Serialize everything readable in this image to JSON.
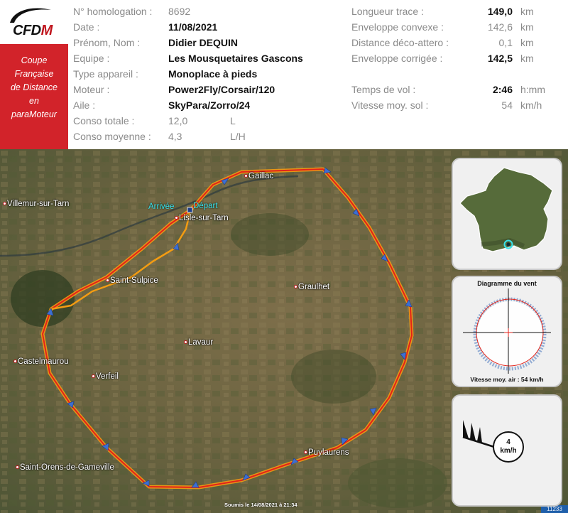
{
  "logo": {
    "text_black": "CFD",
    "text_red": "M"
  },
  "sidebar": {
    "lines": [
      "Coupe",
      "Française",
      "de Distance",
      "en",
      "paraMoteur"
    ]
  },
  "flight": {
    "labels": [
      "N° homologation :",
      "Date :",
      "Prénom, Nom :",
      "Equipe :",
      "Type appareil :",
      "Moteur :",
      "Aile :",
      "Conso totale :",
      "Conso moyenne :"
    ],
    "homologation": "8692",
    "date": "11/08/2021",
    "pilot": "Didier DEQUIN",
    "team": "Les Mousquetaires Gascons",
    "aircraft_type": "Monoplace à pieds",
    "engine": "Power2Fly/Corsair/120",
    "wing": "SkyPara/Zorro/24",
    "conso_totale": "12,0",
    "conso_totale_unit": "L",
    "conso_moyenne": "4,3",
    "conso_moyenne_unit": "L/H"
  },
  "stats": {
    "rows": [
      {
        "label": "Longueur trace :",
        "value": "149,0",
        "unit": "km",
        "bold": true
      },
      {
        "label": "Enveloppe convexe :",
        "value": "142,6",
        "unit": "km",
        "bold": false
      },
      {
        "label": "Distance déco-attero :",
        "value": "0,1",
        "unit": "km",
        "bold": false
      },
      {
        "label": "Enveloppe corrigée :",
        "value": "142,5",
        "unit": "km",
        "bold": true
      }
    ],
    "rows2": [
      {
        "label": "Temps de vol :",
        "value": "2:46",
        "unit": "h:mm",
        "bold": true
      },
      {
        "label": "Vitesse moy. sol :",
        "value": "54",
        "unit": "km/h",
        "bold": false
      }
    ]
  },
  "map": {
    "towns": [
      "Gaillac",
      "Villemur-sur-Tarn",
      "Lisle-sur-Tarn",
      "Saint-Sulpice",
      "Graulhet",
      "Lavaur",
      "Castelmaurou",
      "Verfeil",
      "Puylaurens",
      "Saint-Orens-de-Gameville"
    ],
    "arrival_label": "Arrivée",
    "departure_label": "Départ",
    "footer_note": "Soumis le 14/08/2021 à 21:34",
    "id_badge": "11233",
    "colors": {
      "track_red": "#e2231a",
      "track_orange": "#f39c12",
      "arrow_blue": "#3d6fd1"
    }
  },
  "wind_panel": {
    "title": "Diagramme du vent",
    "footer": "Vitesse moy. air : 54 km/h"
  },
  "wind_arrow_panel": {
    "speed_value": "4",
    "speed_unit": "km/h"
  }
}
